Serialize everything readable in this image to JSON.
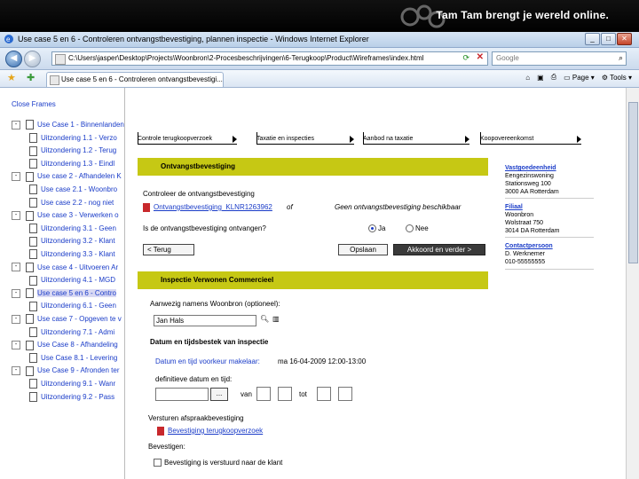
{
  "banner": {
    "brand": "Tam Tam brengt je wereld online."
  },
  "window": {
    "title": "Use case 5 en 6 - Controleren ontvangstbevestiging, plannen inspectie - Windows Internet Explorer",
    "address": "C:\\Users\\jasper\\Desktop\\Projects\\Woonbron\\2-Procesbeschrijvingen\\6-Terugkoop\\Product\\Wireframes\\index.html",
    "search_placeholder": "Google",
    "tab_title": "Use case 5 en 6 - Controleren ontvangstbevestigi...",
    "tools": {
      "page": "Page",
      "tools": "Tools"
    }
  },
  "frames": {
    "header": "Close Frames",
    "items": [
      {
        "toggle": "-",
        "text": "Use Case 1 - Binnenlanden",
        "level": 0
      },
      {
        "text": "Uitzondering 1.1 - Verzo",
        "level": 1
      },
      {
        "text": "Uitzondering 1.2 - Terug",
        "level": 1
      },
      {
        "text": "Uitzondering 1.3 - Eindl",
        "level": 1
      },
      {
        "toggle": "-",
        "text": "Use case 2 - Afhandelen K",
        "level": 0
      },
      {
        "text": "Use case 2.1 - Woonbro",
        "level": 1
      },
      {
        "text": "Use case 2.2 - nog niet",
        "level": 1
      },
      {
        "toggle": "-",
        "text": "Use case 3 - Verwerken o",
        "level": 0
      },
      {
        "text": "Uitzondering 3.1 - Geen",
        "level": 1
      },
      {
        "text": "Uitzondering 3.2 - Klant",
        "level": 1
      },
      {
        "text": "Uitzondering 3.3 - Klant",
        "level": 1
      },
      {
        "toggle": "-",
        "text": "Use case 4 - Uitvoeren Ar",
        "level": 0
      },
      {
        "text": "Uitzondering 4.1 - MGD",
        "level": 1
      },
      {
        "toggle": "-",
        "text": "Use case 5 en 6 - Contro",
        "level": 0,
        "selected": true
      },
      {
        "text": "Uitzondering 6.1 - Geen",
        "level": 1
      },
      {
        "toggle": "-",
        "text": "Use case 7 - Opgeven te v",
        "level": 0
      },
      {
        "text": "Uitzondering 7.1 - Admi",
        "level": 1
      },
      {
        "toggle": "-",
        "text": "Use Case 8 - Afhandeling",
        "level": 0
      },
      {
        "text": "Use Case 8.1 - Levering",
        "level": 1
      },
      {
        "toggle": "-",
        "text": "Use Case 9 - Afronden ter",
        "level": 0
      },
      {
        "text": "Uitzondering 9.1 - Wanr",
        "level": 1
      },
      {
        "text": "Uitzondering 9.2 - Pass",
        "level": 1
      }
    ]
  },
  "steps": [
    "Controle terugkoopverzoek",
    "Taxatie en inspecties",
    "Aanbod na taxatie",
    "Koopovereenkomst"
  ],
  "section1": {
    "title": "Ontvangstbevestiging",
    "instruction": "Controleer de ontvangstbevestiging",
    "doc_link": "Ontvangstbevestiging_KLNR1263962",
    "or": "of",
    "no_doc": "Geen ontvangstbevestiging beschikbaar",
    "question": "Is de ontvangstbevestiging ontvangen?",
    "yes": "Ja",
    "no": "Nee",
    "back": "< Terug",
    "save": "Opslaan",
    "next": "Akkoord en verder >"
  },
  "right": {
    "property_title": "Vastgoedeenheid",
    "property_lines": [
      "Eengezinswoning",
      "Stationsweg 100",
      "3000 AA Rotterdam"
    ],
    "branch_title": "Filiaal",
    "branch_lines": [
      "Woonbron",
      "Wolstraat 750",
      "3014 DA Rotterdam"
    ],
    "contact_title": "Contactpersoon",
    "contact_lines": [
      "D. Werknemer",
      "010-55555555"
    ]
  },
  "section2": {
    "title": "Inspectie Verwonen Commercieel",
    "present_label": "Aanwezig namens Woonbron (optioneel):",
    "present_value": "Jan Hals",
    "datetime_title": "Datum en tijdsbestek van inspectie",
    "proposed_label": "Datum en tijd voorkeur makelaar:",
    "proposed_value": "ma 16-04-2009 12:00-13:00",
    "final_label": "definitieve datum en tijd:",
    "date_btn": "...",
    "from": "van",
    "to": "tot",
    "send_label": "Versturen afspraakbevestiging",
    "send_link": "Bevestiging terugkoopverzoek",
    "confirm_label": "Bevestigen:",
    "confirm_text": "Bevestiging is verstuurd naar de klant"
  }
}
